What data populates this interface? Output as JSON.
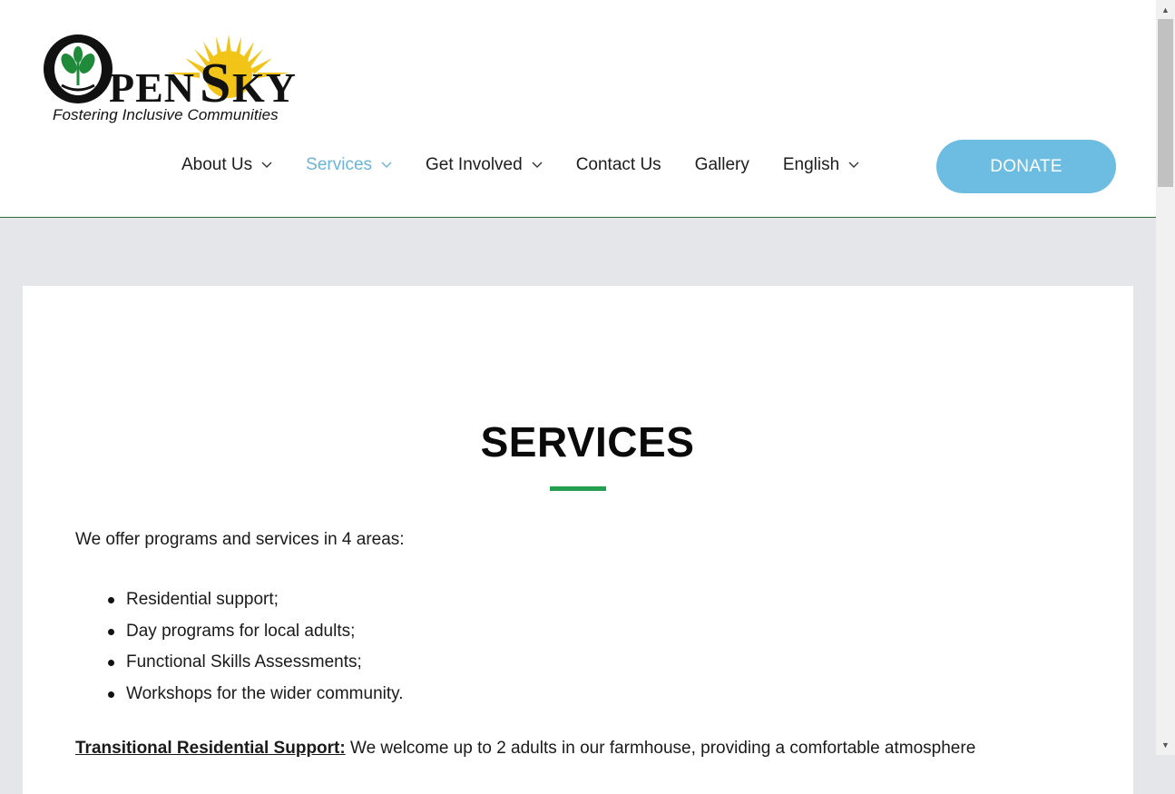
{
  "logo": {
    "wordmark": "OPENSKY",
    "tagline": "Fostering Inclusive Communities"
  },
  "nav": {
    "items": [
      {
        "label": "About Us",
        "has_dropdown": true,
        "active": false
      },
      {
        "label": "Services",
        "has_dropdown": true,
        "active": true
      },
      {
        "label": "Get Involved",
        "has_dropdown": true,
        "active": false
      },
      {
        "label": "Contact Us",
        "has_dropdown": false,
        "active": false
      },
      {
        "label": "Gallery",
        "has_dropdown": false,
        "active": false
      },
      {
        "label": "English",
        "has_dropdown": true,
        "active": false
      }
    ],
    "donate_label": "DONATE"
  },
  "main": {
    "title": "SERVICES",
    "intro": "We offer programs and services in 4 areas:",
    "list": [
      "Residential support;",
      "Day programs for local adults;",
      "Functional Skills Assessments;",
      "Workshops for the wider community."
    ],
    "para_lead": "Transitional Residential Support:",
    "para_text": " We welcome up to 2 adults in our farmhouse, providing a comfortable atmosphere"
  },
  "colors": {
    "active_nav": "#6cb4d8",
    "donate_bg": "#6dbde2",
    "accent_underline": "#22a050",
    "page_bg": "#e4e6ea"
  }
}
